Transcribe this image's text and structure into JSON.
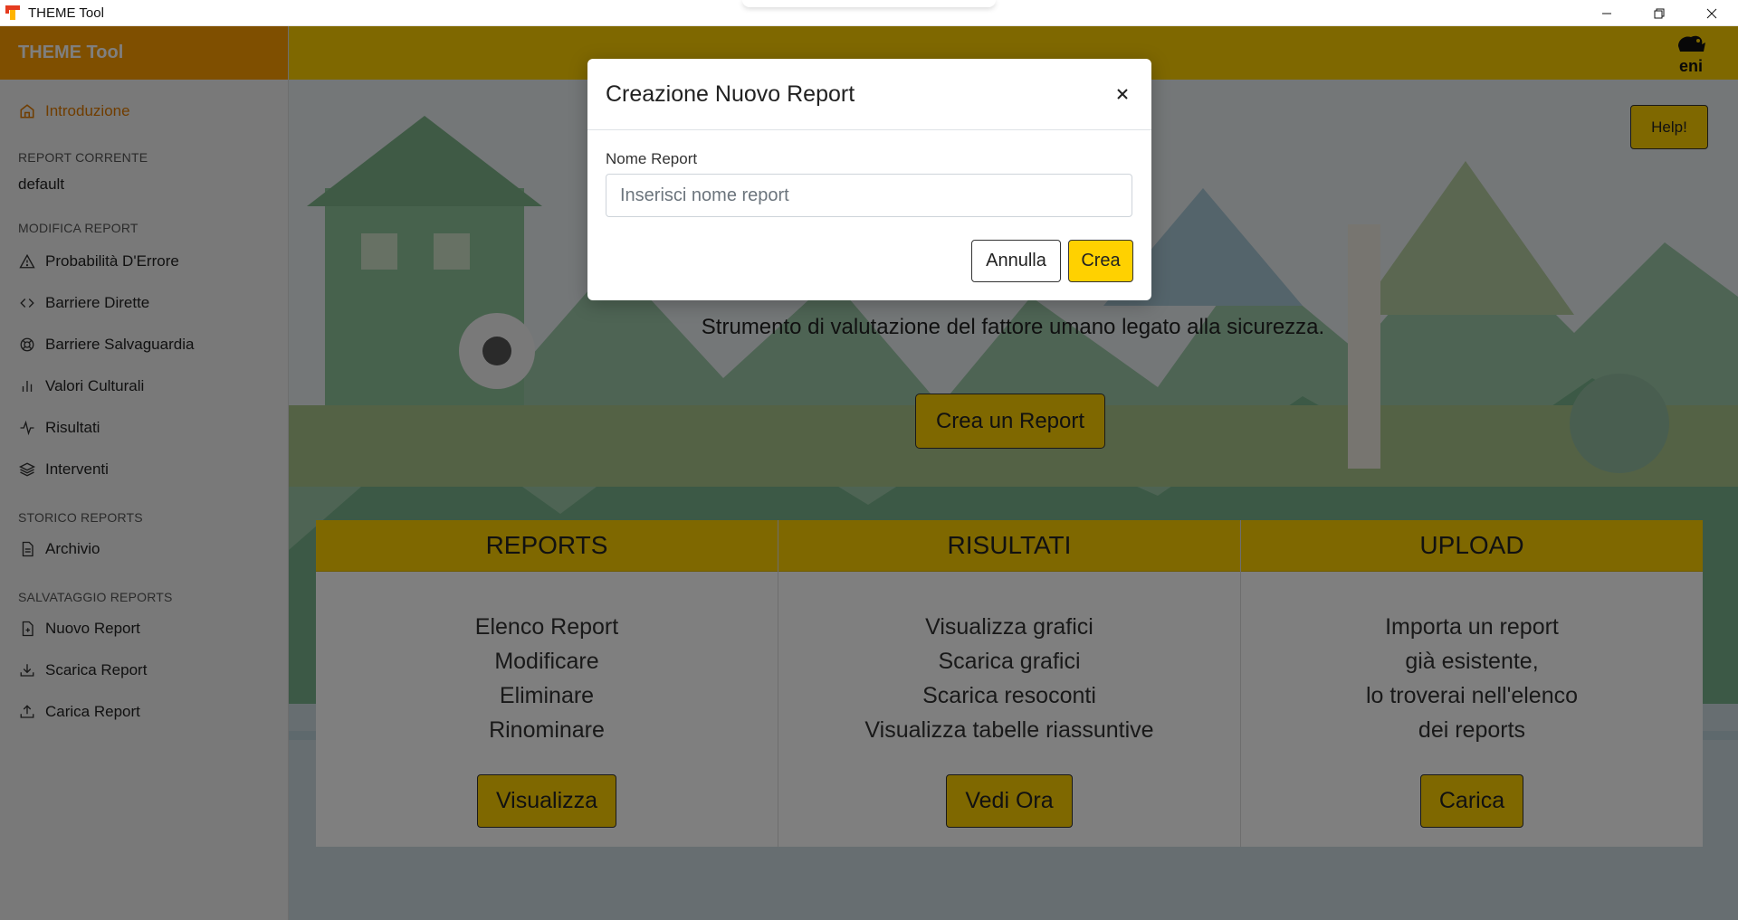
{
  "window": {
    "title": "THEME Tool",
    "controls": [
      "minimize",
      "restore",
      "close"
    ]
  },
  "sidebar": {
    "brand": "THEME Tool",
    "intro": "Introduzione",
    "current_report_heading": "REPORT CORRENTE",
    "current_report_value": "default",
    "modify_heading": "MODIFICA REPORT",
    "modify_items": [
      {
        "label": "Probabilità D'Errore",
        "icon": "warning-icon"
      },
      {
        "label": "Barriere Dirette",
        "icon": "code-icon"
      },
      {
        "label": "Barriere Salvaguardia",
        "icon": "lifebuoy-icon"
      },
      {
        "label": "Valori Culturali",
        "icon": "bar-chart-icon"
      },
      {
        "label": "Risultati",
        "icon": "activity-icon"
      },
      {
        "label": "Interventi",
        "icon": "layers-icon"
      }
    ],
    "history_heading": "STORICO REPORTS",
    "history_items": [
      {
        "label": "Archivio",
        "icon": "file-icon"
      }
    ],
    "save_heading": "SALVATAGGIO REPORTS",
    "save_items": [
      {
        "label": "Nuovo Report",
        "icon": "file-plus-icon"
      },
      {
        "label": "Scarica Report",
        "icon": "download-icon"
      },
      {
        "label": "Carica Report",
        "icon": "upload-icon"
      }
    ]
  },
  "topbar": {
    "logo_text": "eni"
  },
  "main": {
    "help_label": "Help!",
    "hero_text": "Strumento di valutazione del fattore umano legato alla sicurezza.",
    "hero_button": "Crea un Report",
    "cards": [
      {
        "title": "REPORTS",
        "lines": [
          "Elenco Report",
          "Modificare",
          "Eliminare",
          "Rinominare"
        ],
        "button": "Visualizza"
      },
      {
        "title": "RISULTATI",
        "lines": [
          "Visualizza grafici",
          "Scarica grafici",
          "Scarica resoconti",
          "Visualizza tabelle riassuntive"
        ],
        "button": "Vedi Ora"
      },
      {
        "title": "UPLOAD",
        "lines": [
          "Importa un report",
          "già esistente,",
          "lo troverai nell'elenco",
          "dei reports"
        ],
        "button": "Carica"
      }
    ]
  },
  "modal": {
    "title": "Creazione Nuovo Report",
    "close_symbol": "×",
    "field_label": "Nome Report",
    "field_placeholder": "Inserisci nome report",
    "field_value": "",
    "cancel_label": "Annulla",
    "create_label": "Crea"
  },
  "colors": {
    "accent_yellow": "#ffd100",
    "brand_orange": "#ff9f00",
    "active_nav": "#e07b00"
  }
}
